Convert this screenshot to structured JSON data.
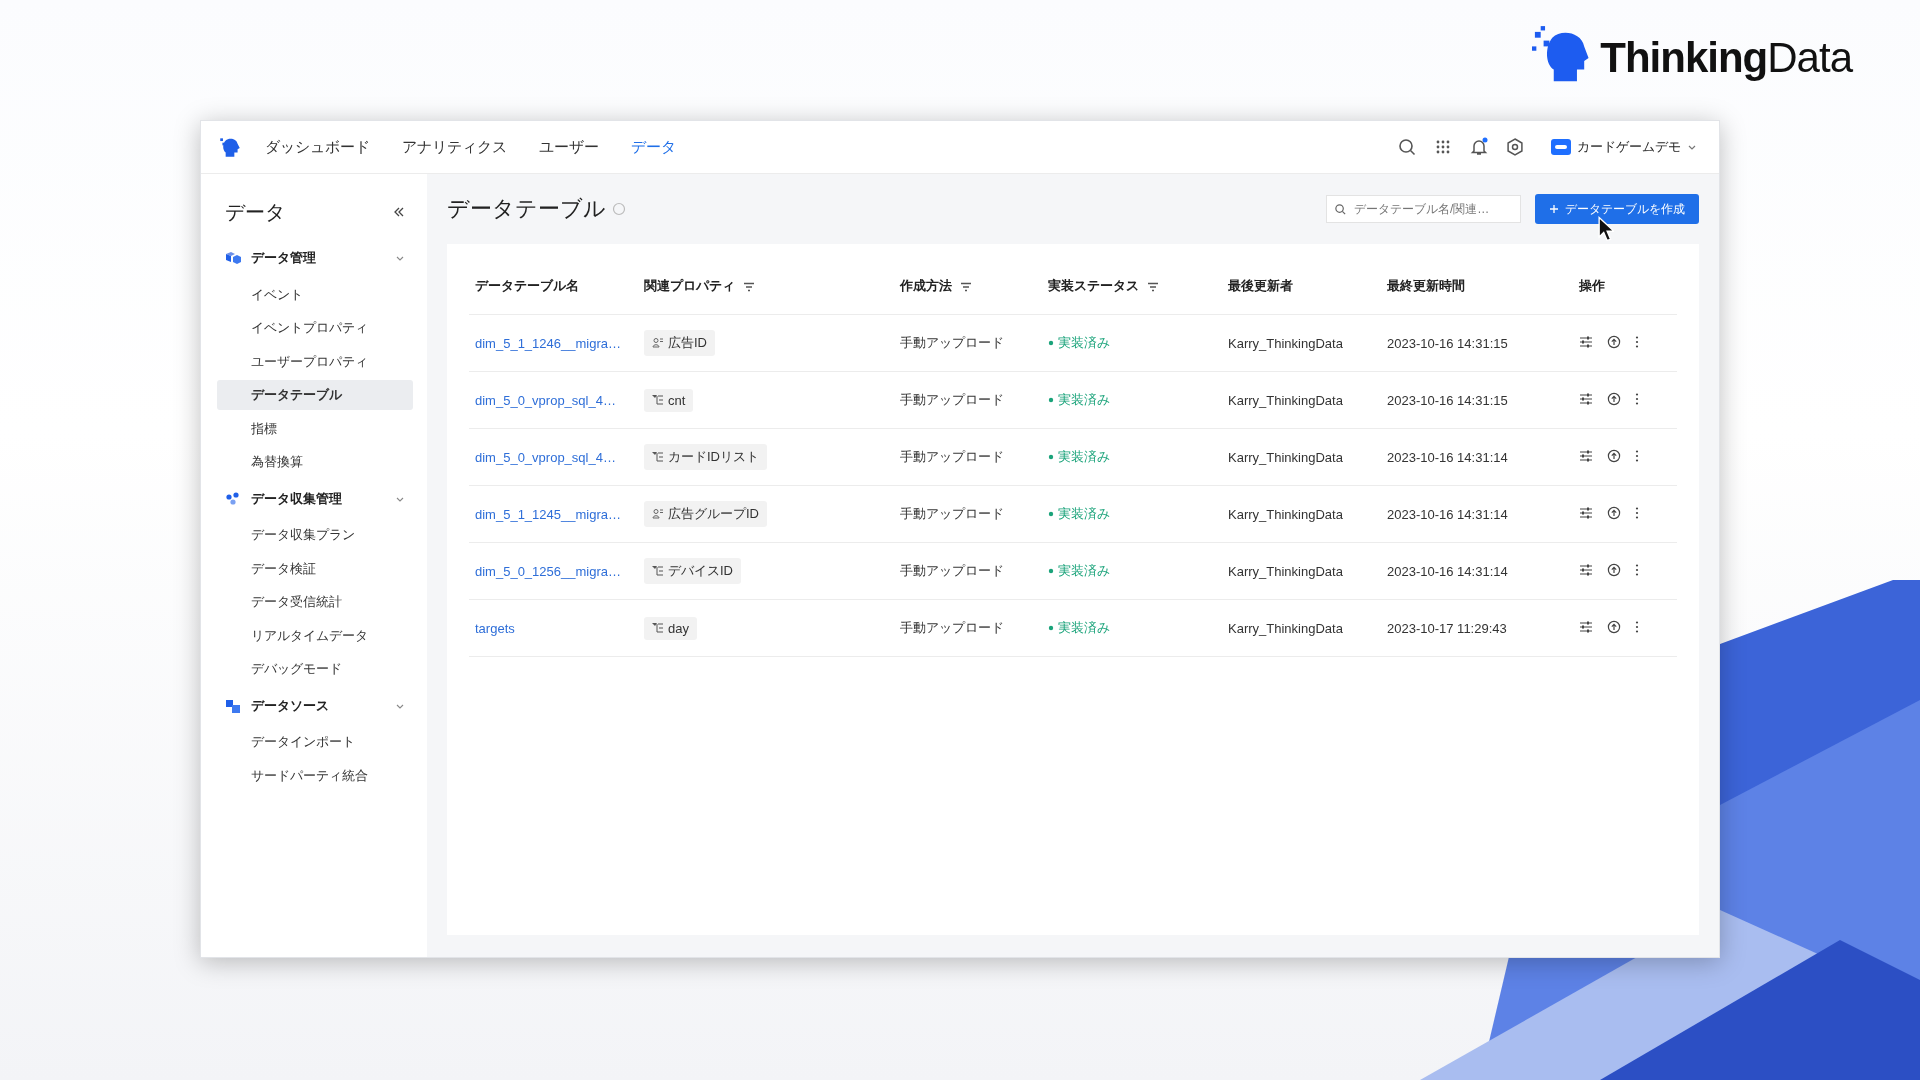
{
  "logo": {
    "text": "**Thinking**Data"
  },
  "nav": {
    "tabs": [
      {
        "label": "ダッシュボード",
        "selected": false
      },
      {
        "label": "アナリティクス",
        "selected": false
      },
      {
        "label": "ユーザー",
        "selected": false
      },
      {
        "label": "データ",
        "selected": true
      }
    ],
    "notification_dot": true,
    "account": "カードゲームデモ"
  },
  "sidebar": {
    "title": "データ",
    "groups": [
      {
        "label": "データ管理",
        "expanded": true,
        "items": [
          {
            "label": "イベント",
            "selected": false
          },
          {
            "label": "イベントプロパティ",
            "selected": false
          },
          {
            "label": "ユーザープロパティ",
            "selected": false
          },
          {
            "label": "データテーブル",
            "selected": true
          },
          {
            "label": "指標",
            "selected": false
          },
          {
            "label": "為替換算",
            "selected": false
          }
        ]
      },
      {
        "label": "データ収集管理",
        "expanded": true,
        "items": [
          {
            "label": "データ収集プラン",
            "selected": false
          },
          {
            "label": "データ検証",
            "selected": false
          },
          {
            "label": "データ受信統計",
            "selected": false
          },
          {
            "label": "リアルタイムデータ",
            "selected": false
          },
          {
            "label": "デバッグモード",
            "selected": false
          }
        ]
      },
      {
        "label": "データソース",
        "expanded": true,
        "items": [
          {
            "label": "データインポート",
            "selected": false
          },
          {
            "label": "サードパーティ統合",
            "selected": false
          }
        ]
      }
    ]
  },
  "page": {
    "title": "データテーブル",
    "search": {
      "placeholder": "データテーブル名/関連…"
    },
    "create_button": "データテーブルを作成"
  },
  "table": {
    "columns": [
      {
        "label": "データテーブル名",
        "filter": false
      },
      {
        "label": "関連プロパティ",
        "filter": true
      },
      {
        "label": "作成方法",
        "filter": true
      },
      {
        "label": "実装ステータス",
        "filter": true
      },
      {
        "label": "最後更新者",
        "filter": false
      },
      {
        "label": "最終更新時間",
        "filter": false
      },
      {
        "label": "操作",
        "filter": false
      }
    ],
    "rows": [
      {
        "name": "dim_5_1_1246__migra…",
        "property": {
          "kind": "user",
          "label": "広告ID"
        },
        "method": "手動アップロード",
        "status": "実装済み",
        "updater": "Karry_ThinkingData",
        "updated": "2023-10-16 14:31:15"
      },
      {
        "name": "dim_5_0_vprop_sql_4…",
        "property": {
          "kind": "dimension",
          "label": "cnt"
        },
        "method": "手動アップロード",
        "status": "実装済み",
        "updater": "Karry_ThinkingData",
        "updated": "2023-10-16 14:31:15"
      },
      {
        "name": "dim_5_0_vprop_sql_4…",
        "property": {
          "kind": "dimension",
          "label": "カードIDリスト"
        },
        "method": "手動アップロード",
        "status": "実装済み",
        "updater": "Karry_ThinkingData",
        "updated": "2023-10-16 14:31:14"
      },
      {
        "name": "dim_5_1_1245__migra…",
        "property": {
          "kind": "user",
          "label": "広告グループID"
        },
        "method": "手動アップロード",
        "status": "実装済み",
        "updater": "Karry_ThinkingData",
        "updated": "2023-10-16 14:31:14"
      },
      {
        "name": "dim_5_0_1256__migra…",
        "property": {
          "kind": "dimension",
          "label": "デバイスID"
        },
        "method": "手動アップロード",
        "status": "実装済み",
        "updater": "Karry_ThinkingData",
        "updated": "2023-10-16 14:31:14"
      },
      {
        "name": "targets",
        "property": {
          "kind": "dimension",
          "label": "day"
        },
        "method": "手動アップロード",
        "status": "実装済み",
        "updater": "Karry_ThinkingData",
        "updated": "2023-10-17 11:29:43"
      }
    ]
  }
}
